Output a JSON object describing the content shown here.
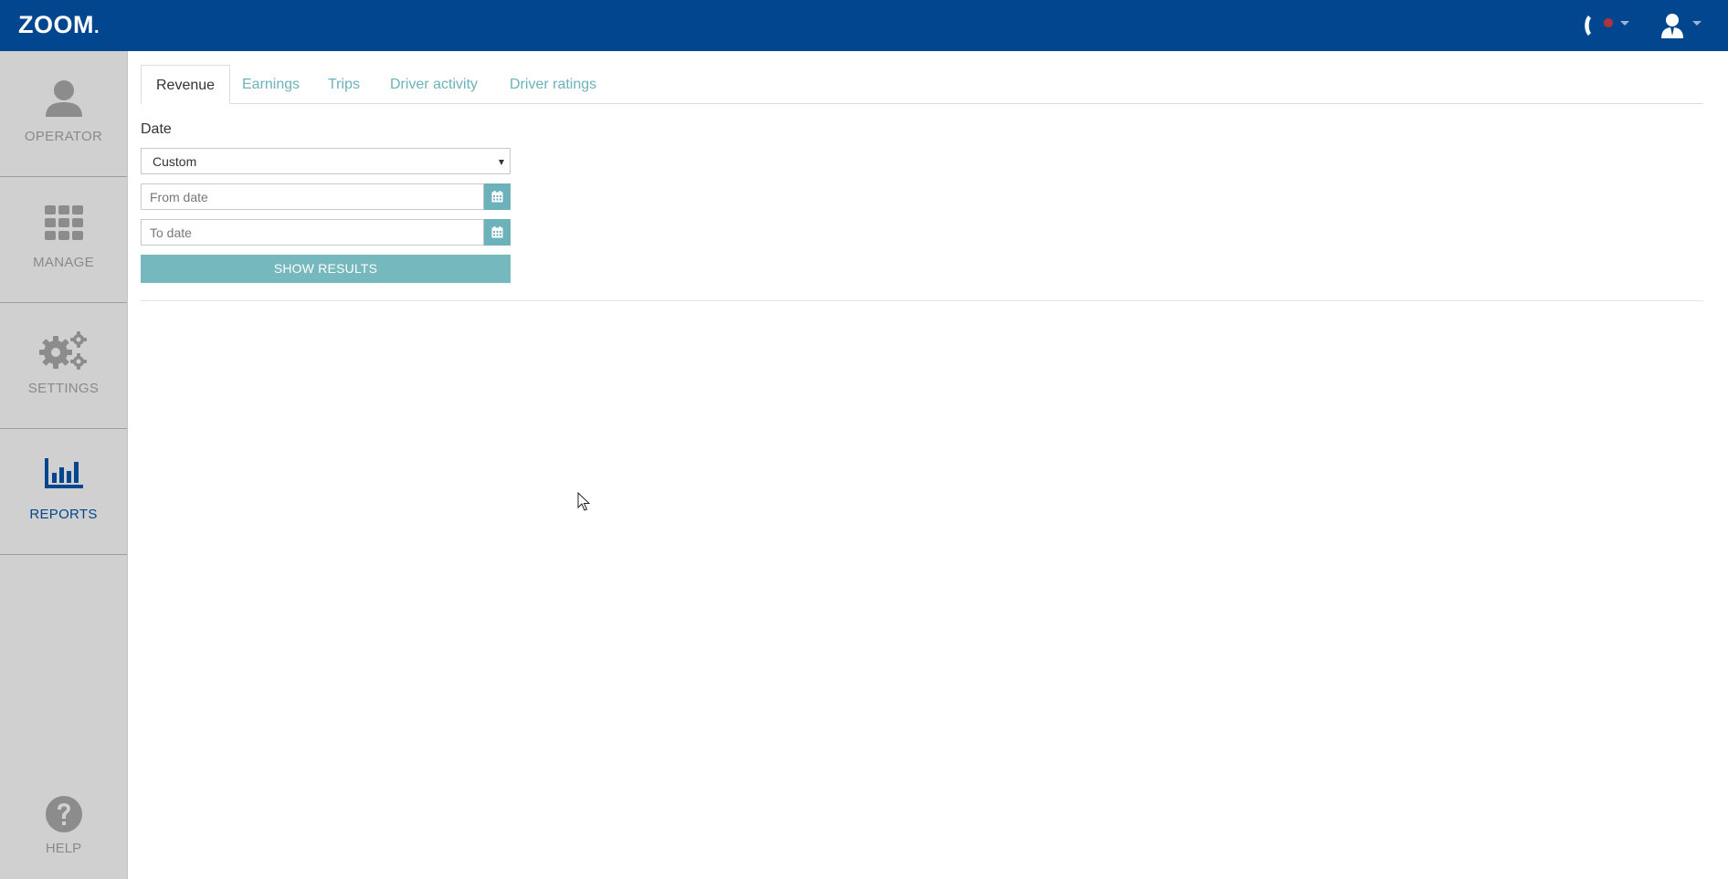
{
  "app": {
    "logo": "ZOOM",
    "logo_dot": "."
  },
  "topbar": {
    "phone_icon": "phone-icon",
    "status_color": "#b0343f",
    "user_icon": "user-icon"
  },
  "sidebar": {
    "items": [
      {
        "label": "OPERATOR",
        "icon": "operator-icon"
      },
      {
        "label": "MANAGE",
        "icon": "grid-icon"
      },
      {
        "label": "SETTINGS",
        "icon": "gears-icon"
      },
      {
        "label": "REPORTS",
        "icon": "bar-chart-icon",
        "active": true
      }
    ],
    "help": {
      "label": "HELP",
      "icon": "help-icon"
    }
  },
  "tabs": [
    {
      "label": "Revenue",
      "active": true
    },
    {
      "label": "Earnings"
    },
    {
      "label": "Trips"
    },
    {
      "label": "Driver activity"
    },
    {
      "label": "Driver ratings"
    }
  ],
  "form": {
    "date_label": "Date",
    "date_select_value": "Custom",
    "from_placeholder": "From date",
    "to_placeholder": "To date",
    "show_results_label": "SHOW RESULTS"
  },
  "colors": {
    "brand": "#01468e",
    "accent": "#6bb2ba",
    "sidebar_bg": "#d0d0d0"
  }
}
